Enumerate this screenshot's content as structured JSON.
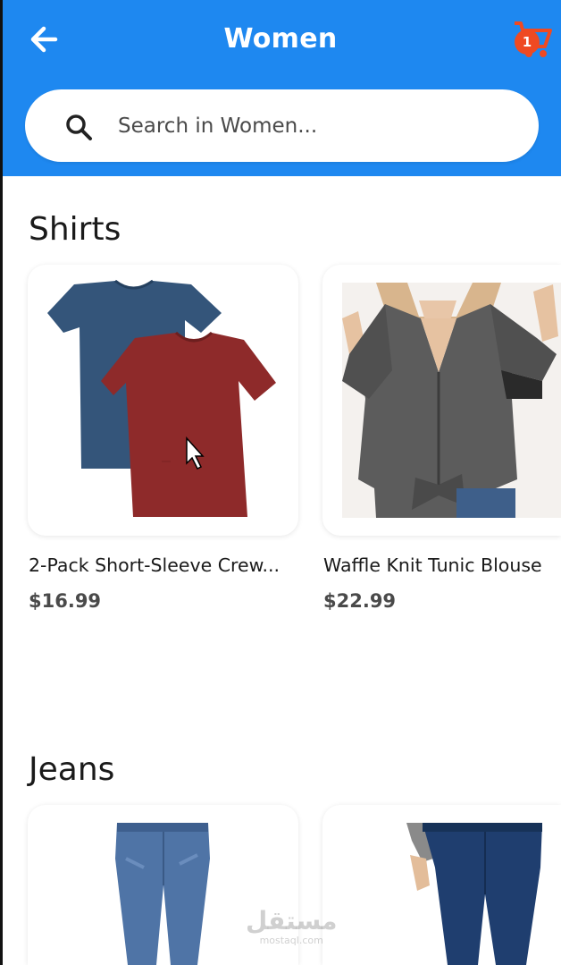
{
  "header": {
    "title": "Women",
    "cart_badge": "1",
    "icons": {
      "back": "arrow-left-icon",
      "cart": "shopping-cart-icon"
    },
    "colors": {
      "appbar": "#1e88f0",
      "badge": "#ef4a22"
    }
  },
  "search": {
    "placeholder": "Search in Women...",
    "value": "",
    "icon": "search-icon"
  },
  "sections": [
    {
      "title": "Shirts",
      "products": [
        {
          "name": "2-Pack Short-Sleeve Crew...",
          "price": "$16.99",
          "image": "two-tshirts-navy-and-red"
        },
        {
          "name": "Waffle Knit Tunic Blouse",
          "price": "$22.99",
          "image": "grey-waffle-knit-blouse"
        }
      ]
    },
    {
      "title": "Jeans",
      "products": [
        {
          "name": "",
          "price": "",
          "image": "skinny-jeans-light-wash"
        },
        {
          "name": "",
          "price": "",
          "image": "skinny-jeans-dark-wash"
        }
      ]
    }
  ],
  "watermark": {
    "arabic": "مستقل",
    "latin": "mostaql.com"
  }
}
